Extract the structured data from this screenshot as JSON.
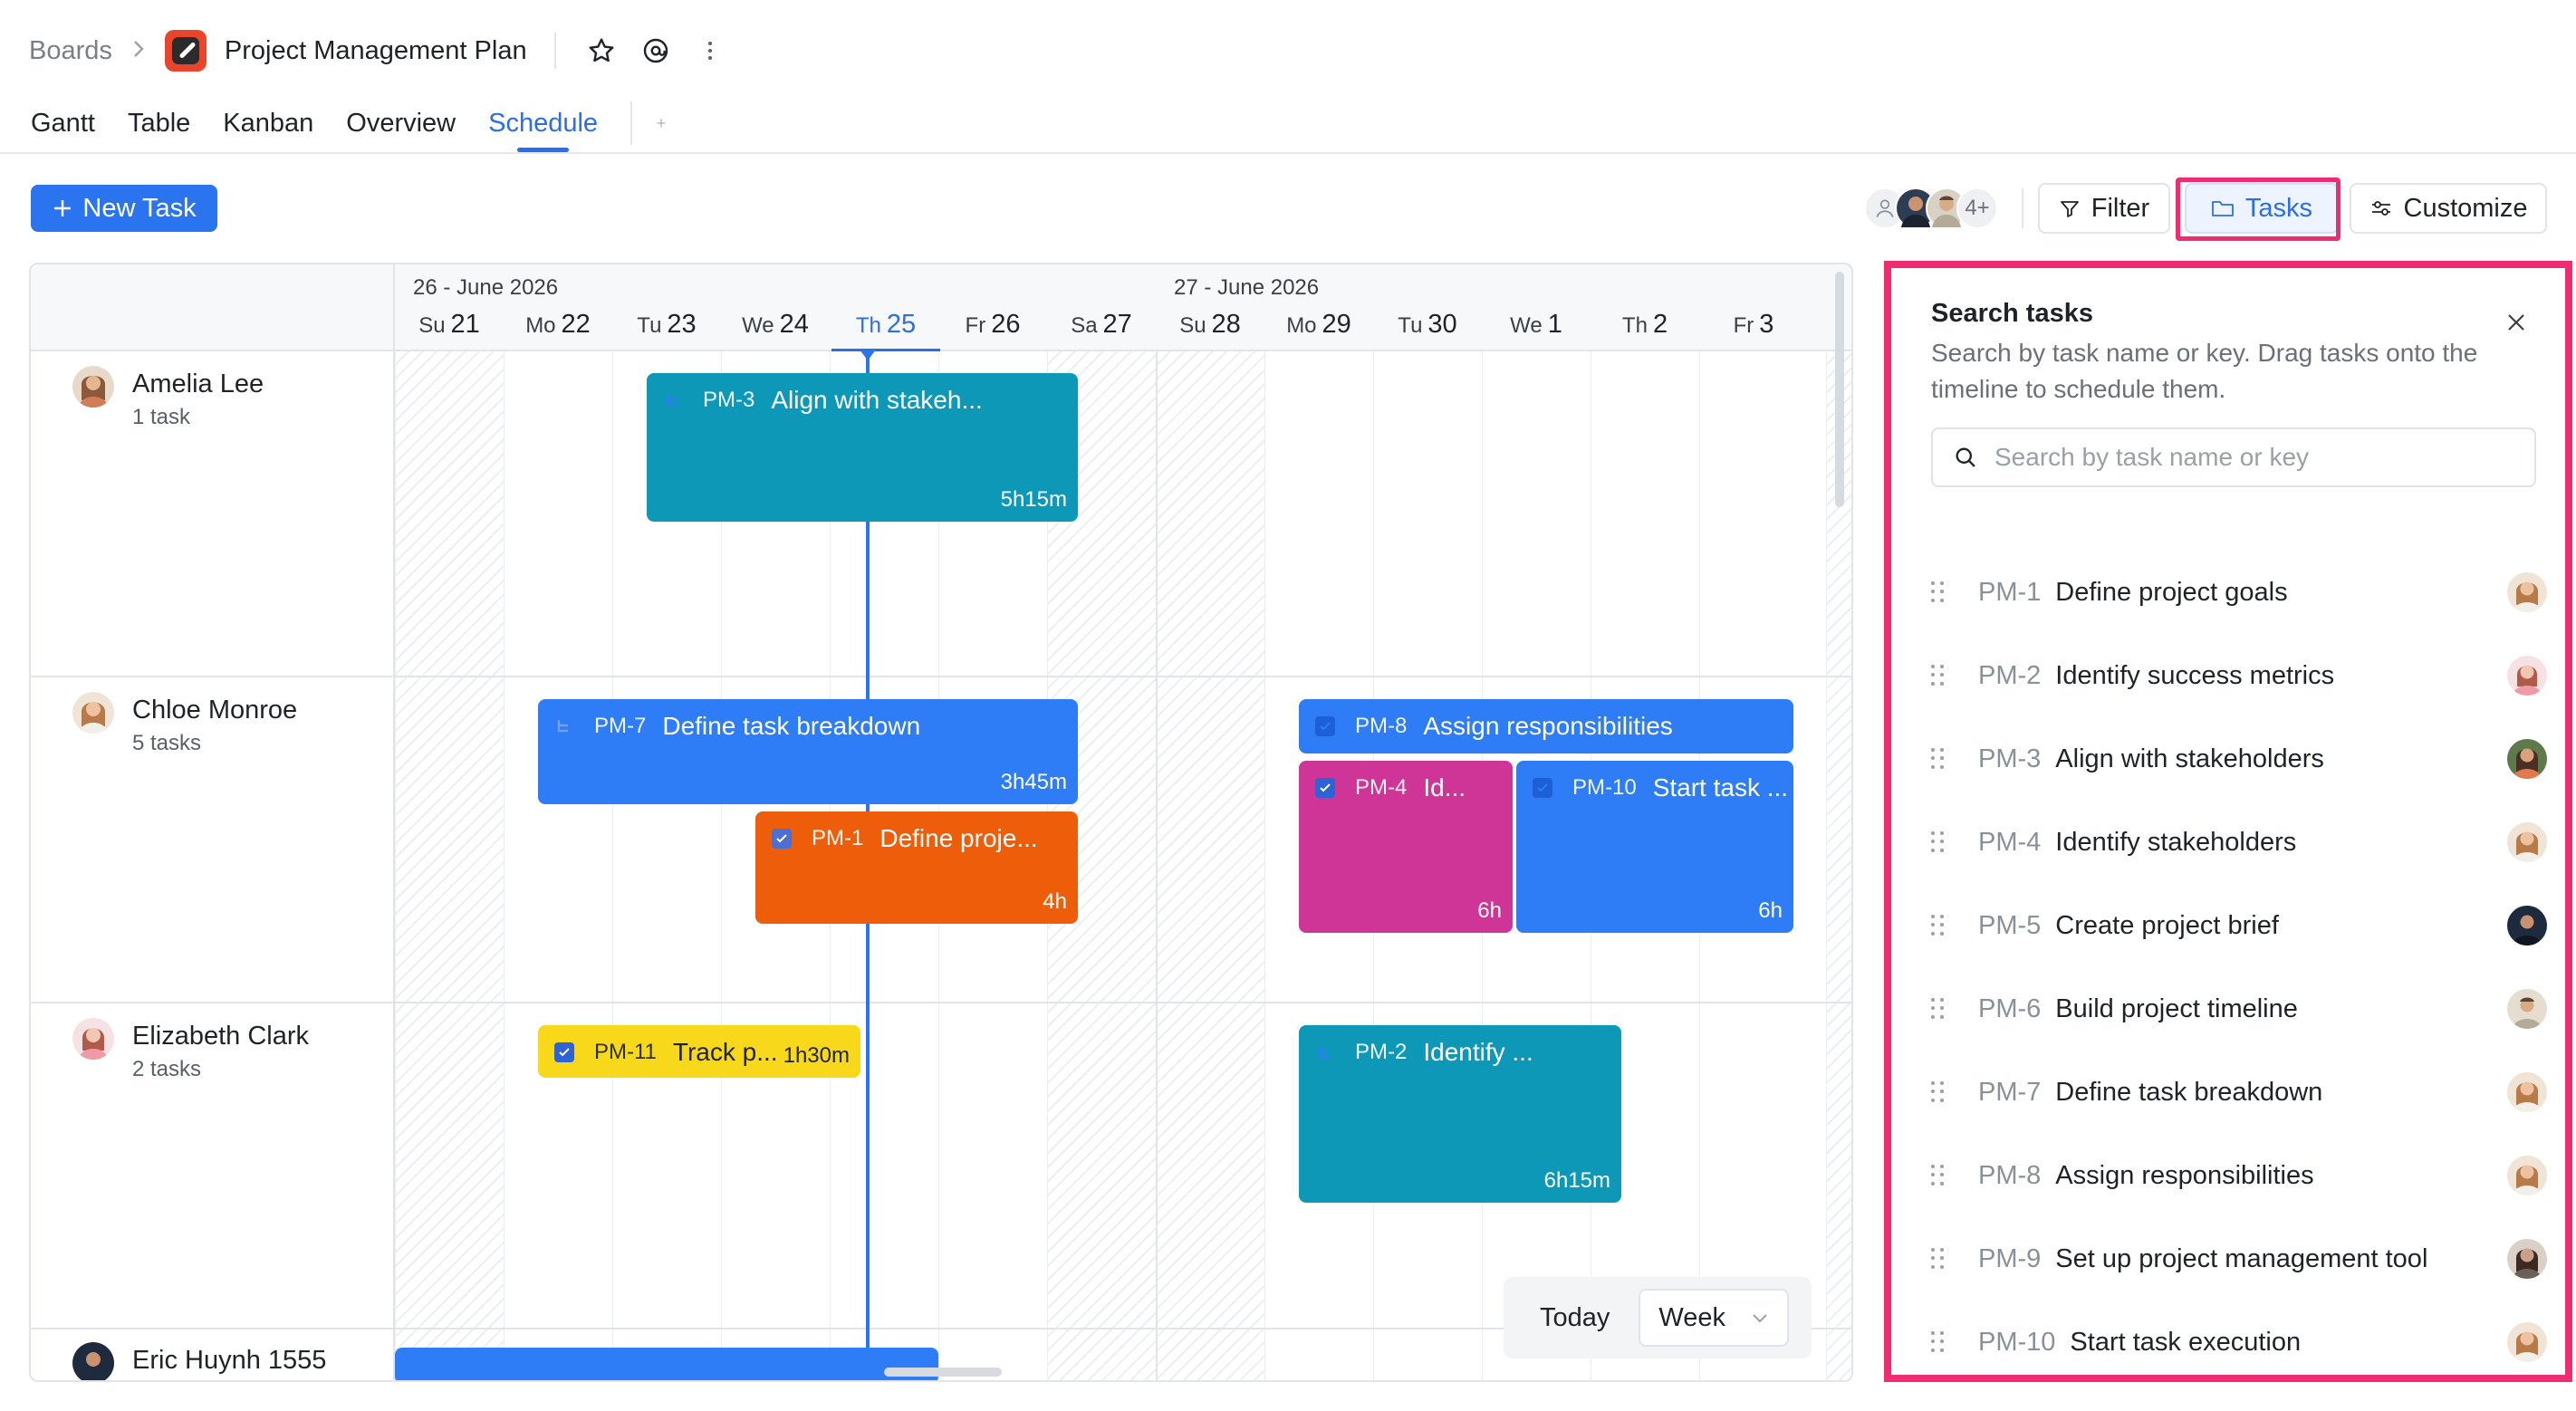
{
  "breadcrumb": {
    "root": "Boards",
    "project": "Project Management Plan"
  },
  "tabs": [
    {
      "label": "Gantt",
      "active": false
    },
    {
      "label": "Table",
      "active": false
    },
    {
      "label": "Kanban",
      "active": false
    },
    {
      "label": "Overview",
      "active": false
    },
    {
      "label": "Schedule",
      "active": true
    }
  ],
  "toolbar": {
    "new_task": "New Task",
    "members_more": "4+",
    "filter": "Filter",
    "tasks": "Tasks",
    "customize": "Customize"
  },
  "schedule": {
    "weeks": [
      "26 - June 2026",
      "27 - June 2026"
    ],
    "days": [
      {
        "dow": "Su",
        "num": "21"
      },
      {
        "dow": "Mo",
        "num": "22"
      },
      {
        "dow": "Tu",
        "num": "23"
      },
      {
        "dow": "We",
        "num": "24"
      },
      {
        "dow": "Th",
        "num": "25"
      },
      {
        "dow": "Fr",
        "num": "26"
      },
      {
        "dow": "Sa",
        "num": "27"
      },
      {
        "dow": "Su",
        "num": "28"
      },
      {
        "dow": "Mo",
        "num": "29"
      },
      {
        "dow": "Tu",
        "num": "30"
      },
      {
        "dow": "We",
        "num": "1"
      },
      {
        "dow": "Th",
        "num": "2"
      },
      {
        "dow": "Fr",
        "num": "3"
      }
    ],
    "today_index": 4,
    "people": [
      {
        "name": "Amelia Lee",
        "count": "1 task"
      },
      {
        "name": "Chloe Monroe",
        "count": "5 tasks"
      },
      {
        "name": "Elizabeth Clark",
        "count": "2 tasks"
      },
      {
        "name": "Eric Huynh 1555",
        "count": ""
      }
    ],
    "tasks": [
      {
        "key": "PM-3",
        "title": "Align with stakeh...",
        "duration": "5h15m",
        "color": "#0e98b8"
      },
      {
        "key": "PM-7",
        "title": "Define task breakdown",
        "duration": "3h45m",
        "color": "#2e7cf6"
      },
      {
        "key": "PM-1",
        "title": "Define proje...",
        "duration": "4h",
        "color": "#ee5e0a"
      },
      {
        "key": "PM-8",
        "title": "Assign responsibilities",
        "duration": "",
        "color": "#2e7cf6"
      },
      {
        "key": "PM-4",
        "title": "Id...",
        "duration": "6h",
        "color": "#cf3596"
      },
      {
        "key": "PM-10",
        "title": "Start task ...",
        "duration": "6h",
        "color": "#2e7cf6"
      },
      {
        "key": "PM-11",
        "title": "Track p...",
        "duration": "1h30m",
        "color": "#f7d81b"
      },
      {
        "key": "PM-2",
        "title": "Identify ...",
        "duration": "6h15m",
        "color": "#0e98b8"
      }
    ],
    "today_label": "Today",
    "view": "Week"
  },
  "panel": {
    "title": "Search tasks",
    "description": "Search by task name or key. Drag tasks onto the timeline to schedule them.",
    "search_placeholder": "Search by task name or key",
    "items": [
      {
        "key": "PM-1",
        "name": "Define project goals"
      },
      {
        "key": "PM-2",
        "name": "Identify success metrics"
      },
      {
        "key": "PM-3",
        "name": "Align with stakeholders"
      },
      {
        "key": "PM-4",
        "name": "Identify stakeholders"
      },
      {
        "key": "PM-5",
        "name": "Create project brief"
      },
      {
        "key": "PM-6",
        "name": "Build project timeline"
      },
      {
        "key": "PM-7",
        "name": "Define task breakdown"
      },
      {
        "key": "PM-8",
        "name": "Assign responsibilities"
      },
      {
        "key": "PM-9",
        "name": "Set up project management tool"
      },
      {
        "key": "PM-10",
        "name": "Start task execution"
      }
    ]
  },
  "colors": {
    "accent": "#2b74ef",
    "highlight": "#ef2c6f"
  }
}
